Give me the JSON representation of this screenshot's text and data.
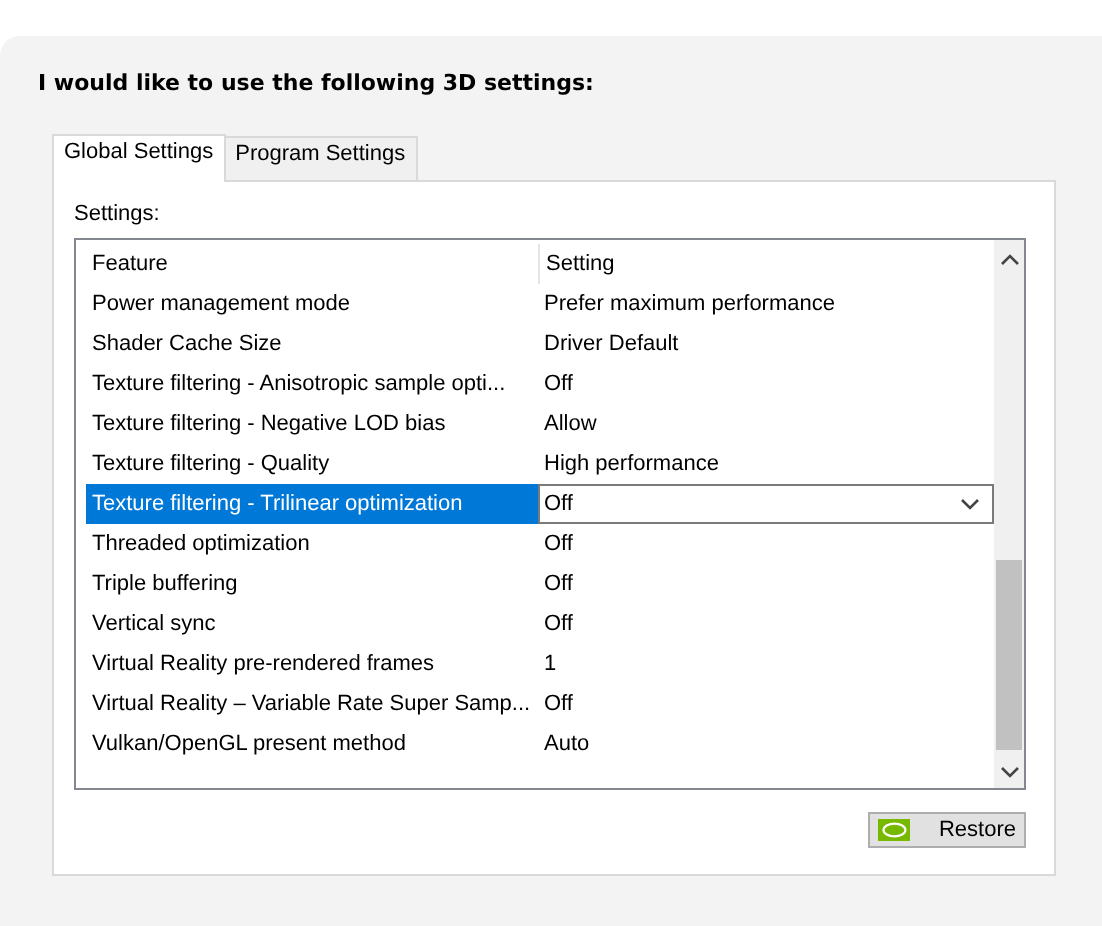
{
  "heading": "I would like to use the following 3D settings:",
  "tabs": [
    {
      "label": "Global Settings",
      "selected": true
    },
    {
      "label": "Program Settings",
      "selected": false
    }
  ],
  "settings_label": "Settings:",
  "table": {
    "columns": [
      "Feature",
      "Setting"
    ],
    "rows": [
      {
        "feature": "Power management mode",
        "setting": "Prefer maximum performance",
        "selected": false
      },
      {
        "feature": "Shader Cache Size",
        "setting": "Driver Default",
        "selected": false
      },
      {
        "feature": "Texture filtering - Anisotropic sample opti...",
        "setting": "Off",
        "selected": false
      },
      {
        "feature": "Texture filtering - Negative LOD bias",
        "setting": "Allow",
        "selected": false
      },
      {
        "feature": "Texture filtering - Quality",
        "setting": "High performance",
        "selected": false
      },
      {
        "feature": "Texture filtering - Trilinear optimization",
        "setting": "Off",
        "selected": true
      },
      {
        "feature": "Threaded optimization",
        "setting": "Off",
        "selected": false
      },
      {
        "feature": "Triple buffering",
        "setting": "Off",
        "selected": false
      },
      {
        "feature": "Vertical sync",
        "setting": "Off",
        "selected": false
      },
      {
        "feature": "Virtual Reality pre-rendered frames",
        "setting": "1",
        "selected": false
      },
      {
        "feature": "Virtual Reality – Variable Rate Super Samp...",
        "setting": "Off",
        "selected": false
      },
      {
        "feature": "Vulkan/OpenGL present method",
        "setting": "Auto",
        "selected": false
      }
    ]
  },
  "restore_button": "Restore"
}
